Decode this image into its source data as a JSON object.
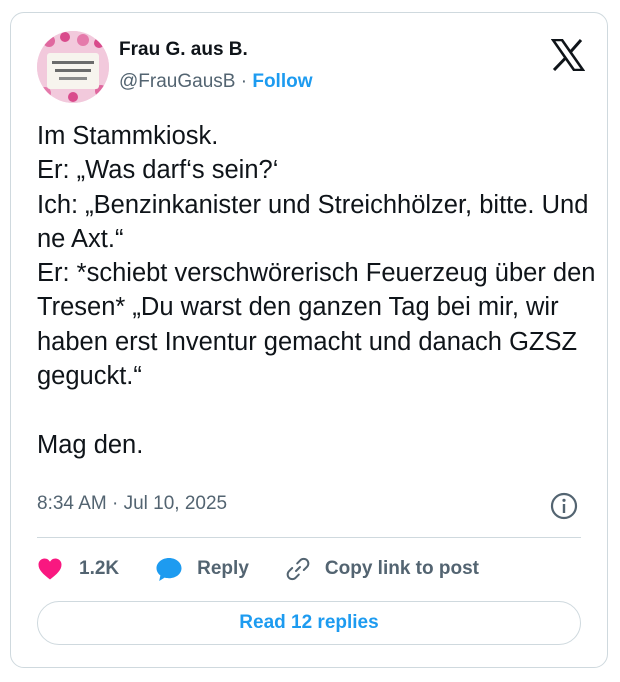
{
  "author": {
    "display_name": "Frau G. aus B.",
    "handle": "@FrauGausB",
    "separator": "·",
    "follow_label": "Follow",
    "avatar": "mug-photo-avatar"
  },
  "brand": {
    "logo": "x-logo-icon"
  },
  "tweet": {
    "text": "Im Stammkiosk.\nEr: „Was darf‘s sein?‘\nIch: „Benzinkanister und Streichhölzer, bitte. Und ne Axt.“\nEr: *schiebt verschwörerisch Feuerzeug über den Tresen* „Du warst den ganzen Tag bei mir, wir haben erst Inventur gemacht und danach GZSZ geguckt.“\n\nMag den.",
    "timestamp": "8:34 AM · Jul 10, 2025"
  },
  "actions": {
    "like_count": "1.2K",
    "reply_label": "Reply",
    "copy_label": "Copy link to post",
    "read_replies_label": "Read 12 replies"
  },
  "colors": {
    "like": "#f91880",
    "accent": "#1d9bf0",
    "text": "#0f1419",
    "secondary": "#536471",
    "border": "#cfd9de"
  },
  "icons": {
    "heart": "heart-icon",
    "reply": "speech-bubble-icon",
    "copy": "link-icon",
    "info": "info-icon"
  }
}
